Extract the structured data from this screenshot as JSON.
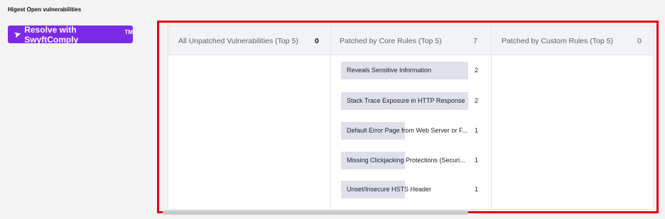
{
  "section": {
    "title": "Higest Open vulnerabilities"
  },
  "resolve_button": {
    "label": "Resolve with SwyftComply",
    "tm": "TM",
    "icon": "rocket-icon"
  },
  "columns": [
    {
      "title": "All Unpatched Vulnerabilities (Top 5)",
      "count": "0"
    },
    {
      "title": "Patched by Core Rules (Top 5)",
      "count": "7"
    },
    {
      "title": "Patched by Custom Rules (Top 5)",
      "count": "0"
    }
  ],
  "core_rules": [
    {
      "label": "Reveals Sensitive Information",
      "count": "2",
      "fill": 0.78
    },
    {
      "label": "Stack Trace Exposure in HTTP Response",
      "count": "2",
      "fill": 0.78
    },
    {
      "label": "Default Error Page from Web Server or F...",
      "count": "1",
      "fill": 0.39
    },
    {
      "label": "Missing Clickjacking Protections (Securi...",
      "count": "1",
      "fill": 0.39
    },
    {
      "label": "Unset/Insecure HSTS Header",
      "count": "1",
      "fill": 0.39
    }
  ],
  "colors": {
    "accent": "#7b2be8",
    "highlight_frame": "#e6000a",
    "bar": "#dfe0ec"
  }
}
